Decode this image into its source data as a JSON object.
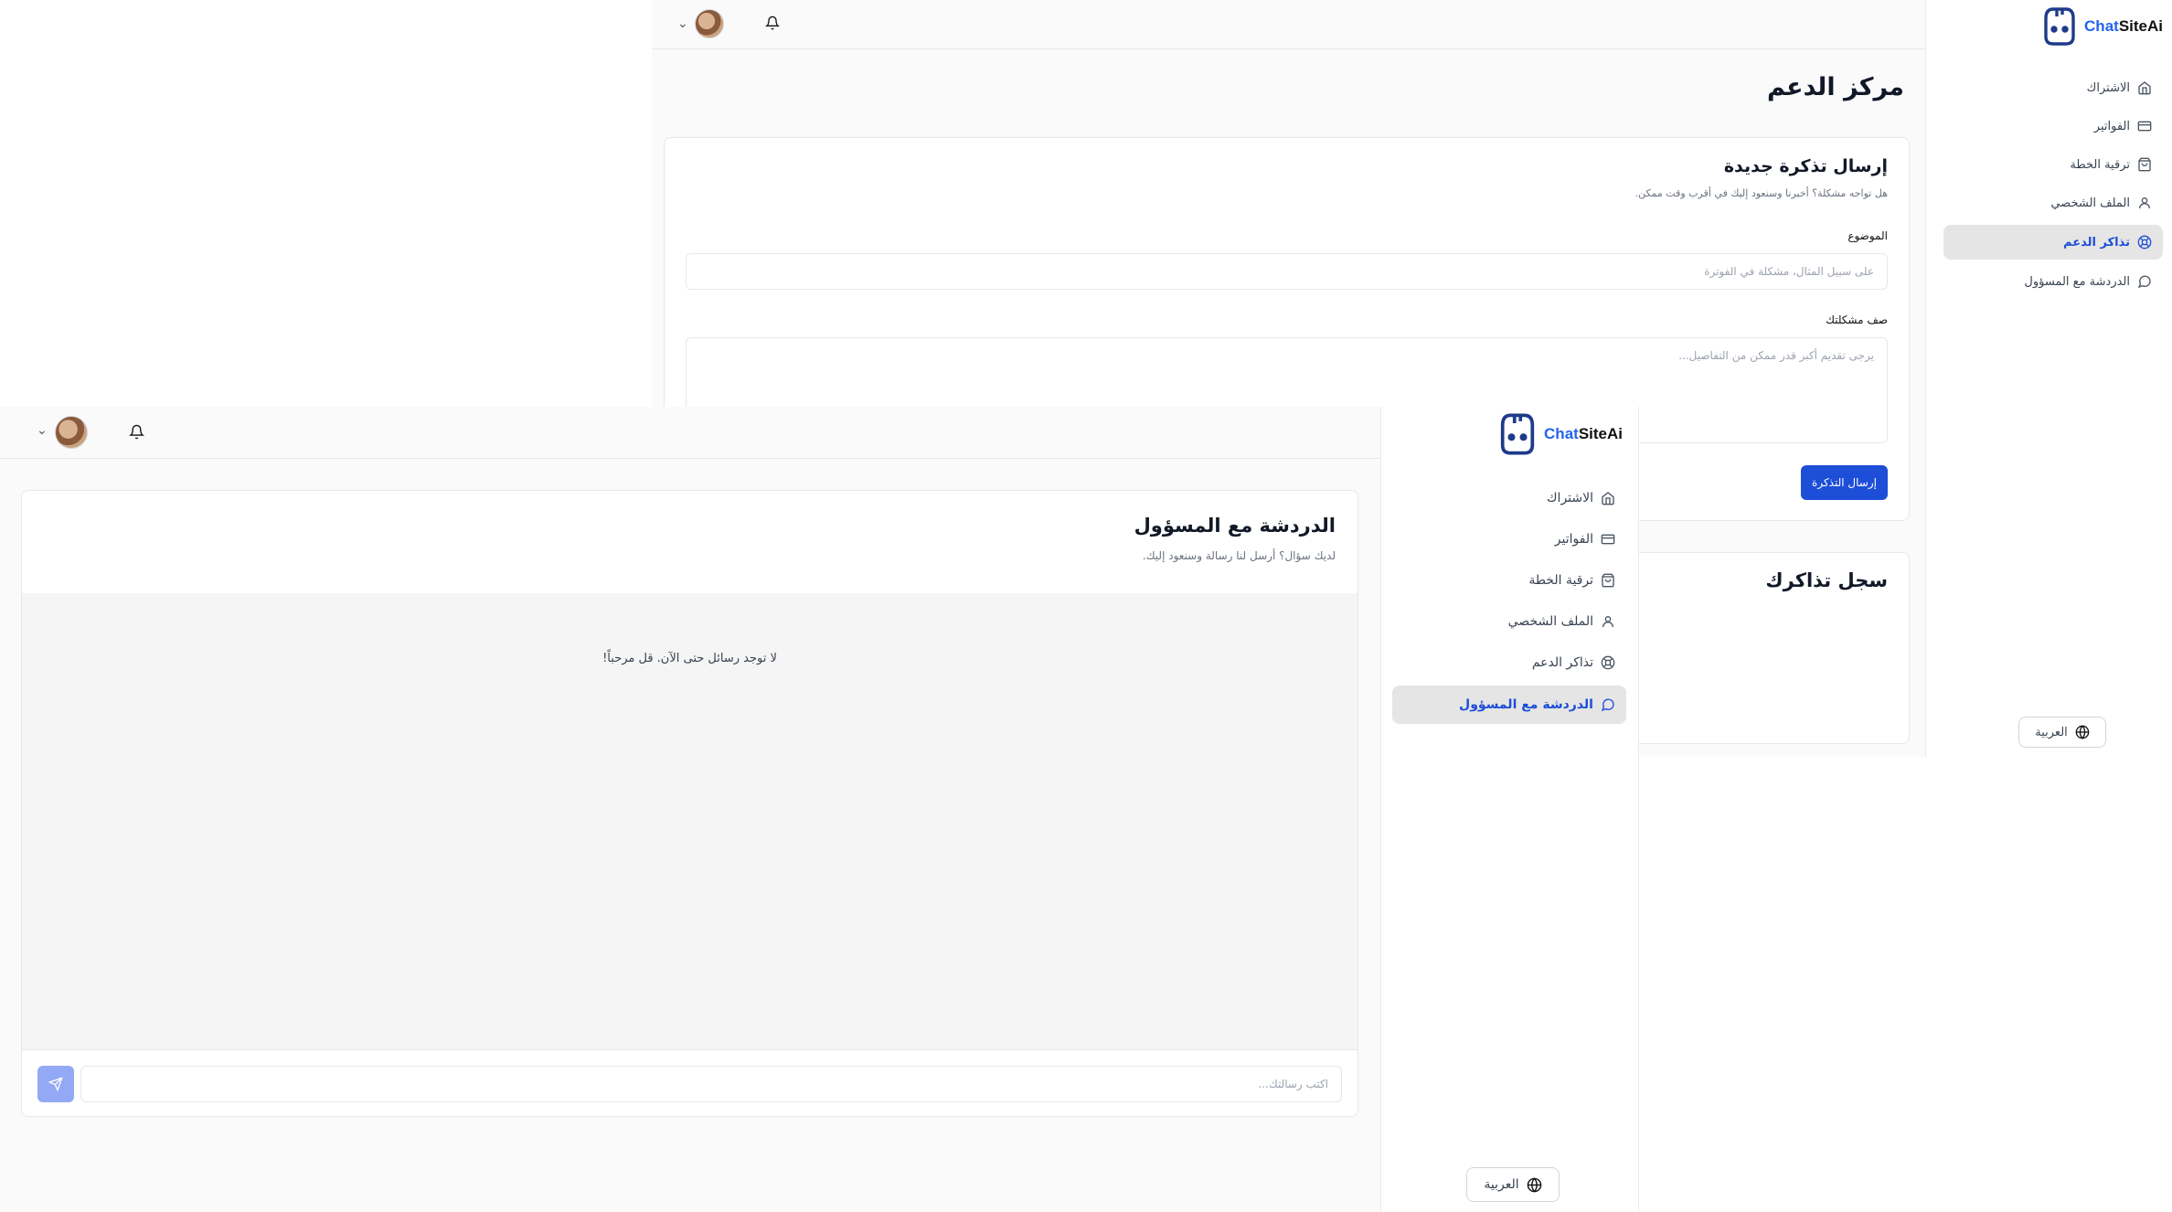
{
  "brand": {
    "name_prefix": "Chat",
    "name_suffix": "SiteAi"
  },
  "back_window": {
    "sidebar": {
      "items": [
        {
          "label": "الاشتراك",
          "icon": "home-icon"
        },
        {
          "label": "الفواتير",
          "icon": "credit-card-icon"
        },
        {
          "label": "ترقية الخطة",
          "icon": "shopping-bag-icon"
        },
        {
          "label": "الملف الشخصي",
          "icon": "user-icon"
        },
        {
          "label": "تذاكر الدعم",
          "icon": "lifebuoy-icon",
          "active": true
        },
        {
          "label": "الدردشة مع المسؤول",
          "icon": "message-circle-icon"
        }
      ],
      "language": "العربية"
    },
    "page_title": "مركز الدعم",
    "new_ticket": {
      "title": "إرسال تذكرة جديدة",
      "subtitle": "هل تواجه مشكلة؟ أخبرنا وسنعود إليك في أقرب وقت ممكن.",
      "subject_label": "الموضوع",
      "subject_placeholder": "على سبيل المثال، مشكلة في الفوترة",
      "description_label": "صف مشكلتك",
      "description_placeholder": "يرجى تقديم أكبر قدر ممكن من التفاصيل...",
      "submit_label": "إرسال التذكرة"
    },
    "history": {
      "title": "سجل تذاكرك"
    }
  },
  "front_window": {
    "sidebar": {
      "items": [
        {
          "label": "الاشتراك",
          "icon": "home-icon"
        },
        {
          "label": "الفواتير",
          "icon": "credit-card-icon"
        },
        {
          "label": "ترقية الخطة",
          "icon": "shopping-bag-icon"
        },
        {
          "label": "الملف الشخصي",
          "icon": "user-icon"
        },
        {
          "label": "تذاكر الدعم",
          "icon": "lifebuoy-icon"
        },
        {
          "label": "الدردشة مع المسؤول",
          "icon": "message-circle-icon",
          "active": true
        }
      ],
      "language": "العربية"
    },
    "chat": {
      "title": "الدردشة مع المسؤول",
      "subtitle": "لديك سؤال؟ أرسل لنا رسالة وسنعود إليك.",
      "empty_message": "لا توجد رسائل حتى الآن. قل مرحباً!",
      "input_placeholder": "اكتب رسالتك..."
    }
  },
  "colors": {
    "accent": "#1d4ed8",
    "send_button": "#93a9f5",
    "active_nav_bg": "#e5e5e5"
  }
}
